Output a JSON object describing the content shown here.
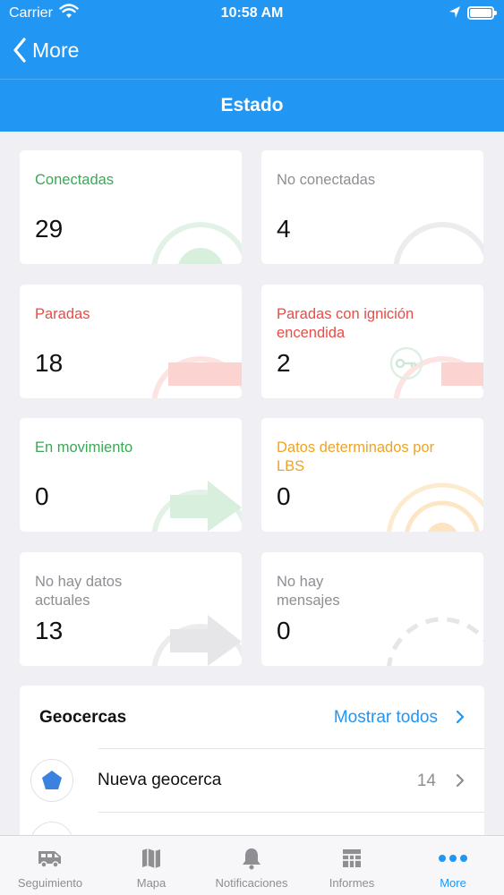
{
  "status_bar": {
    "carrier": "Carrier",
    "time": "10:58 AM"
  },
  "nav": {
    "back_label": "More",
    "title": "Estado"
  },
  "cards": [
    {
      "label": "Conectadas",
      "count": "29",
      "color": "#3aa856"
    },
    {
      "label": "No conectadas",
      "count": "4",
      "color": "#8e8e93"
    },
    {
      "label": "Paradas",
      "count": "18",
      "color": "#e94b45"
    },
    {
      "label": "Paradas con ignición encendida",
      "count": "2",
      "color": "#e94b45"
    },
    {
      "label": "En movimiento",
      "count": "0",
      "color": "#3aa856"
    },
    {
      "label": "Datos determinados por LBS",
      "count": "0",
      "color": "#f0a323"
    },
    {
      "label": "No hay datos actuales",
      "count": "13",
      "color": "#8e8e93"
    },
    {
      "label": "No hay mensajes",
      "count": "0",
      "color": "#8e8e93"
    }
  ],
  "geofences": {
    "title": "Geocercas",
    "show_all": "Mostrar todos",
    "items": [
      {
        "name": "Nueva geocerca",
        "count": "14",
        "icon": "pentagon-icon",
        "icon_color": "#3b82e0"
      }
    ]
  },
  "tabs": [
    {
      "label": "Seguimiento",
      "icon": "van-icon",
      "active": false
    },
    {
      "label": "Mapa",
      "icon": "map-icon",
      "active": false
    },
    {
      "label": "Notificaciones",
      "icon": "bell-icon",
      "active": false
    },
    {
      "label": "Informes",
      "icon": "table-icon",
      "active": false
    },
    {
      "label": "More",
      "icon": "more-dots-icon",
      "active": true
    }
  ],
  "colors": {
    "accent": "#2196f3",
    "background": "#efeff4"
  }
}
